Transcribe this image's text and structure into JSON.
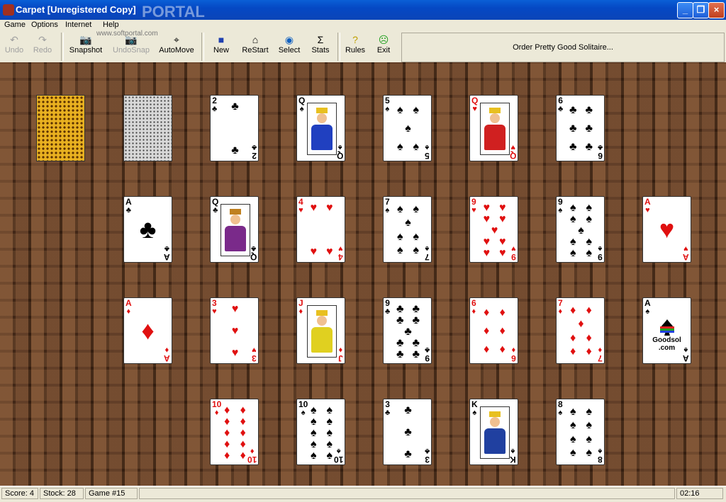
{
  "window": {
    "title": "Carpet [Unregistered Copy]",
    "watermark": "PORTAL",
    "site_watermark": "www.softportal.com"
  },
  "menu": [
    "Game",
    "Options",
    "Internet",
    "Help"
  ],
  "toolbar": {
    "undo": "Undo",
    "redo": "Redo",
    "snapshot": "Snapshot",
    "undosnap": "UndoSnap",
    "automove": "AutoMove",
    "new": "New",
    "restart": "ReStart",
    "select": "Select",
    "stats": "Stats",
    "rules": "Rules",
    "exit": "Exit",
    "order": "Order Pretty Good Solitaire..."
  },
  "cards": {
    "r0c2": {
      "rank": "2",
      "suit": "♣"
    },
    "r0c3": {
      "rank": "Q",
      "suit": "♠"
    },
    "r0c4": {
      "rank": "5",
      "suit": "♠"
    },
    "r0c5": {
      "rank": "Q",
      "suit": "♥"
    },
    "r0c6": {
      "rank": "6",
      "suit": "♣"
    },
    "r1c1": {
      "rank": "A",
      "suit": "♣"
    },
    "r1c2": {
      "rank": "Q",
      "suit": "♣"
    },
    "r1c3": {
      "rank": "4",
      "suit": "♥"
    },
    "r1c4": {
      "rank": "7",
      "suit": "♠"
    },
    "r1c5": {
      "rank": "9",
      "suit": "♥"
    },
    "r1c6": {
      "rank": "9",
      "suit": "♠"
    },
    "r1c7": {
      "rank": "A",
      "suit": "♥"
    },
    "r2c1": {
      "rank": "A",
      "suit": "♦"
    },
    "r2c2": {
      "rank": "3",
      "suit": "♥"
    },
    "r2c3": {
      "rank": "J",
      "suit": "♦"
    },
    "r2c4": {
      "rank": "9",
      "suit": "♣"
    },
    "r2c5": {
      "rank": "6",
      "suit": "♦"
    },
    "r2c6": {
      "rank": "7",
      "suit": "♦"
    },
    "r2c7": {
      "rank": "A",
      "suit": "♠"
    },
    "r3c2": {
      "rank": "10",
      "suit": "♦"
    },
    "r3c3": {
      "rank": "10",
      "suit": "♠"
    },
    "r3c4": {
      "rank": "3",
      "suit": "♣"
    },
    "r3c5": {
      "rank": "K",
      "suit": "♠"
    },
    "r3c6": {
      "rank": "8",
      "suit": "♠"
    }
  },
  "goodsol": {
    "line1": "Goodsol",
    "line2": ".com"
  },
  "status": {
    "score": "Score:  4",
    "stock": "Stock: 28",
    "game": "Game #15",
    "time": "02:16"
  }
}
